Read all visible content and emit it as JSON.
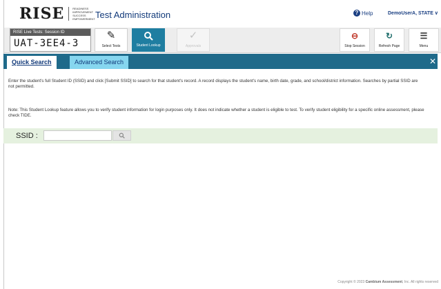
{
  "header": {
    "logo_word": "RISE",
    "logo_subtext": "READINESS IMPROVEMENT SUCCESS EMPOWERMENT",
    "app_title": "Test Administration",
    "help_label": "Help",
    "user_label": "DemoUserA, STATE ∨"
  },
  "toolbar": {
    "session_label": "RISE Live Tests: Session ID",
    "session_id": "UAT-3EE4-3",
    "select_tests_label": "Select Tests",
    "student_lookup_label": "Student Lookup",
    "approvals_label": "Approvals",
    "stop_session_label": "Stop Session",
    "refresh_page_label": "Refresh Page",
    "menu_label": "Menu"
  },
  "tabs": {
    "quick_search": "Quick Search",
    "advanced_search": "Advanced Search",
    "close_symbol": "✕"
  },
  "content": {
    "instructions": "Enter the student's full Student ID (SSID) and click [Submit SSID] to search for that student's record. A record displays the student's name, birth date, grade, and school/district information. Searches by partial SSID are not permitted.",
    "note": "Note: This Student Lookup feature allows you to verify student information for login purposes only. It does not indicate whether a student is eligible to test. To verify student eligibility for a specific online assessment, please check TIDE."
  },
  "ssid_search": {
    "label": "SSID :",
    "input_value": "",
    "placeholder": ""
  },
  "footer": {
    "prefix": "Copyright © 2023 ",
    "company": "Cambium Assessment",
    "suffix": ", Inc. All rights reserved"
  },
  "colors": {
    "brand_blue": "#123a7a",
    "tabbar": "#1f6a8a",
    "active_tool": "#1f7ea1",
    "advanced_tab": "#86d6ef",
    "ssid_bar": "#e5f1df"
  }
}
